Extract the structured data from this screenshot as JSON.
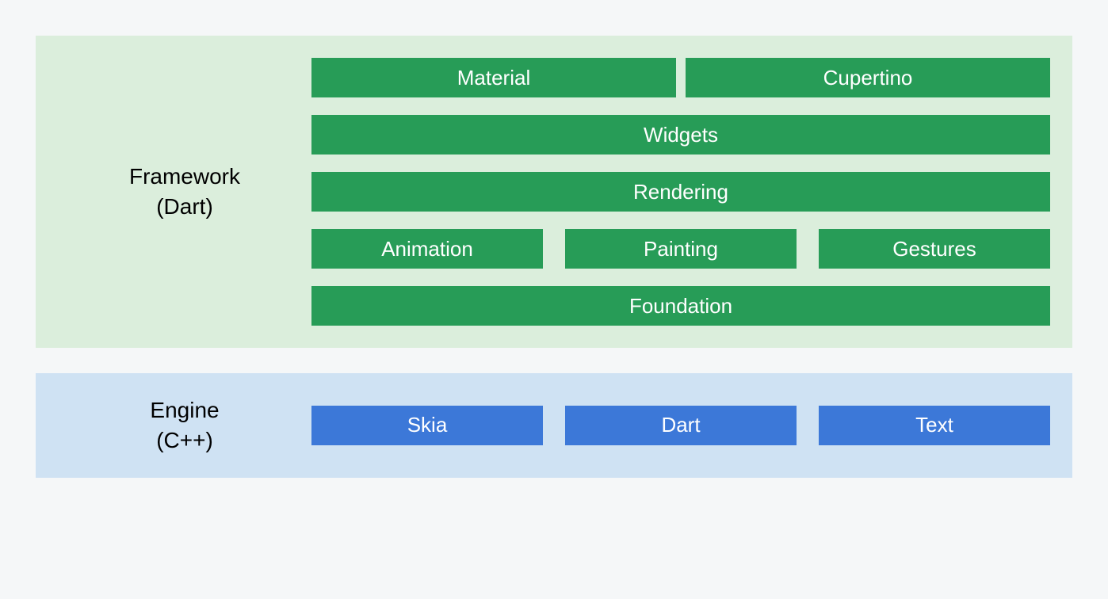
{
  "framework": {
    "title_line1": "Framework",
    "title_line2": "(Dart)",
    "rows": [
      {
        "gap": "narrow",
        "items": [
          "Material",
          "Cupertino"
        ]
      },
      {
        "gap": "narrow",
        "items": [
          "Widgets"
        ]
      },
      {
        "gap": "narrow",
        "items": [
          "Rendering"
        ]
      },
      {
        "gap": "wide",
        "items": [
          "Animation",
          "Painting",
          "Gestures"
        ]
      },
      {
        "gap": "narrow",
        "items": [
          "Foundation"
        ]
      }
    ]
  },
  "engine": {
    "title_line1": "Engine",
    "title_line2": "(C++)",
    "rows": [
      {
        "gap": "wide",
        "items": [
          "Skia",
          "Dart",
          "Text"
        ]
      }
    ]
  },
  "colors": {
    "framework_bg": "#dbeedc",
    "engine_bg": "#cfe2f3",
    "framework_box": "#279c57",
    "engine_box": "#3c78d8"
  }
}
